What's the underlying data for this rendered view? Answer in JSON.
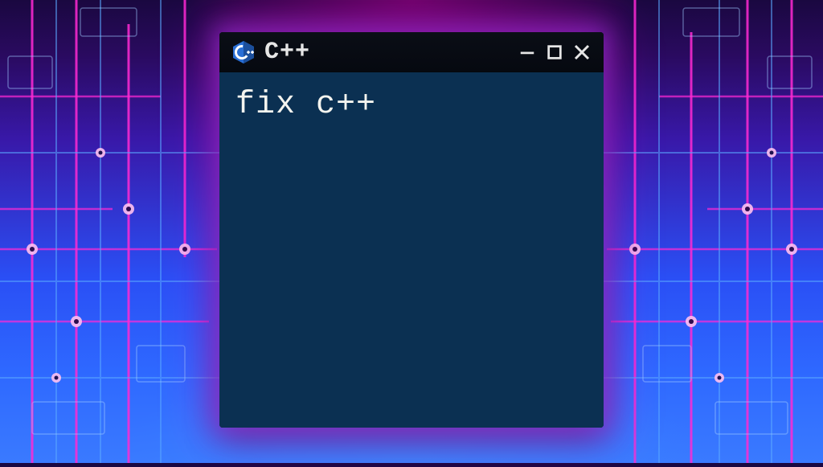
{
  "window": {
    "title": "C++",
    "icon_name": "cpp-logo-icon"
  },
  "content": {
    "line1": "fix c++"
  },
  "colors": {
    "titlebar_bg": "#0a0e16",
    "content_bg": "#0b3052",
    "text": "#f4f4ef",
    "glow_pink": "#ff2ad4",
    "glow_blue": "#2e68ff"
  }
}
